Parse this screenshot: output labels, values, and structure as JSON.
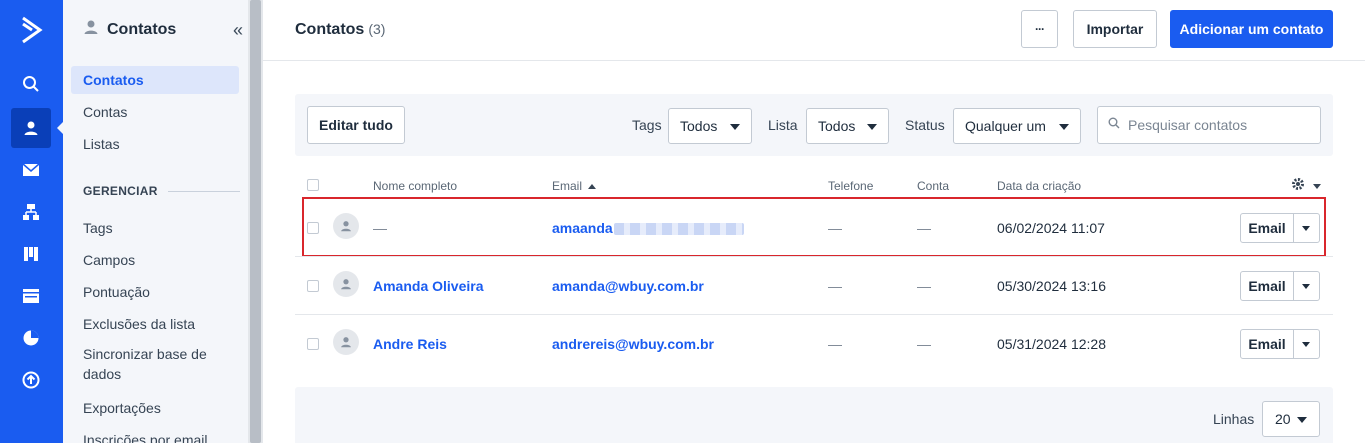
{
  "sidebar": {
    "title": "Contatos",
    "items": [
      {
        "label": "Contatos"
      },
      {
        "label": "Contas"
      },
      {
        "label": "Listas"
      }
    ],
    "section_label": "GERENCIAR",
    "manage_items": [
      {
        "label": "Tags"
      },
      {
        "label": "Campos"
      },
      {
        "label": "Pontuação"
      },
      {
        "label": "Exclusões da lista"
      },
      {
        "label": "Sincronizar base de dados"
      },
      {
        "label": "Exportações"
      },
      {
        "label": "Inscrições por email"
      }
    ]
  },
  "header": {
    "title": "Contatos",
    "count": "(3)",
    "more_label": "···",
    "import_label": "Importar",
    "add_label": "Adicionar um contato"
  },
  "filters": {
    "edit_all_label": "Editar tudo",
    "tags_label": "Tags",
    "tags_value": "Todos",
    "list_label": "Lista",
    "list_value": "Todos",
    "status_label": "Status",
    "status_value": "Qualquer um",
    "search_placeholder": "Pesquisar contatos"
  },
  "table": {
    "columns": [
      "Nome completo",
      "Email",
      "Telefone",
      "Conta",
      "Data da criação"
    ],
    "action_label": "Email",
    "rows": [
      {
        "name": "—",
        "email": "amaanda",
        "phone": "—",
        "account": "—",
        "created": "06/02/2024 11:07"
      },
      {
        "name": "Amanda Oliveira",
        "email": "amanda@wbuy.com.br",
        "phone": "—",
        "account": "—",
        "created": "05/30/2024 13:16"
      },
      {
        "name": "Andre Reis",
        "email": "andrereis@wbuy.com.br",
        "phone": "—",
        "account": "—",
        "created": "05/31/2024 12:28"
      }
    ]
  },
  "footer": {
    "rows_label": "Linhas",
    "rows_value": "20"
  },
  "colors": {
    "primary": "#1a5cf0",
    "highlight": "#d9262c"
  }
}
